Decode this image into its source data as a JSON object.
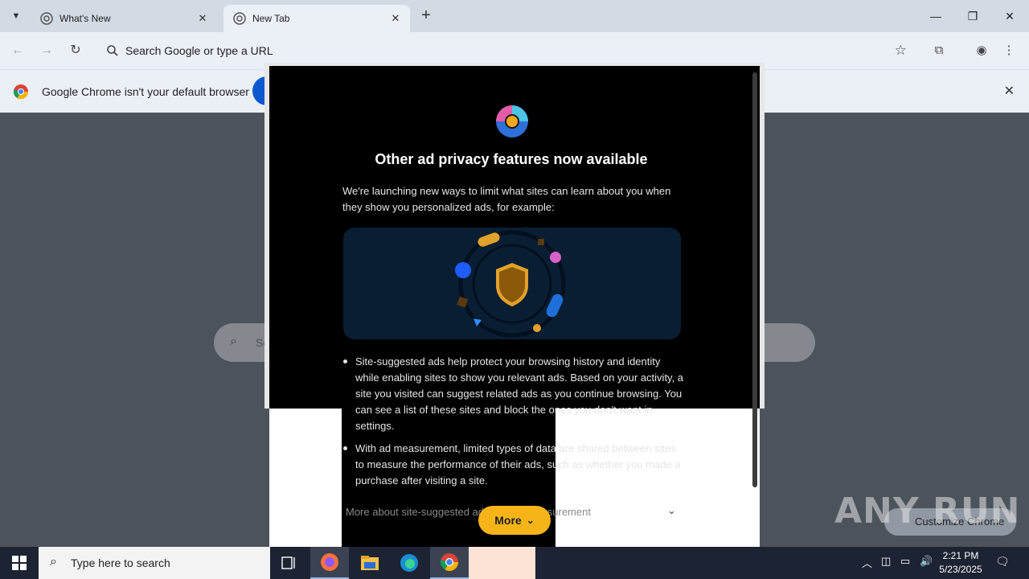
{
  "tabs": [
    {
      "label": "What's New",
      "active": false
    },
    {
      "label": "New Tab",
      "active": true
    }
  ],
  "omnibox": {
    "placeholder": "Search Google or type a URL"
  },
  "infobar": {
    "message": "Google Chrome isn't your default browser"
  },
  "ntp": {
    "search_placeholder": "Se"
  },
  "dialog": {
    "title": "Other ad privacy features now available",
    "intro": "We're launching new ways to limit what sites can learn about you when they show you personalized ads, for example:",
    "bullets": [
      "Site-suggested ads help protect your browsing history and identity while enabling sites to show you relevant ads. Based on your activity, a site you visited can suggest related ads as you continue browsing. You can see a list of these sites and block the ones you don't want in settings.",
      "With ad measurement, limited types of data are shared between sites to measure the performance of their ads, such as whether you made a purchase after visiting a site."
    ],
    "more_about": "More about site-suggested ads and ad measurement",
    "more_button": "More"
  },
  "customize_chrome": "Customize Chrome",
  "watermark": "ANY RUN",
  "taskbar": {
    "search_placeholder": "Type here to search",
    "time": "2:21 PM",
    "date": "5/23/2025"
  },
  "colors": {
    "accent_blue": "#0b57d0",
    "more_button": "#f6b418",
    "dialog_bg": "#000000"
  }
}
